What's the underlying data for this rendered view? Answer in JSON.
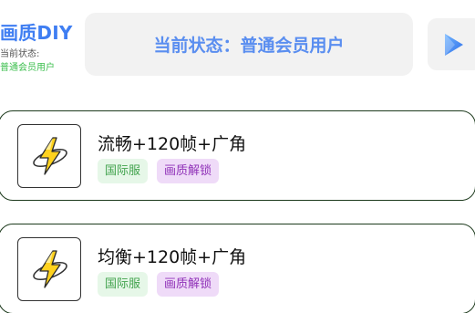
{
  "header": {
    "title": "画质DIY",
    "status_label": "当前状态:",
    "status_value": "普通会员用户",
    "status_banner": "当前状态：普通会员用户"
  },
  "presets": [
    {
      "title": "流畅+120帧+广角",
      "tags": [
        "国际服",
        "画质解锁"
      ],
      "icon": "lightning-bolt-icon"
    },
    {
      "title": "均衡+120帧+广角",
      "tags": [
        "国际服",
        "画质解锁"
      ],
      "icon": "lightning-bolt-icon"
    }
  ],
  "colors": {
    "brand": "#3f7ef2",
    "status_text": "#5a8ef0",
    "member_green": "#3cbf4e",
    "tag_server_bg": "#e6f7e8",
    "tag_server_text": "#41a34d",
    "tag_unlock_bg": "#efdbf8",
    "tag_unlock_text": "#9032b8"
  }
}
